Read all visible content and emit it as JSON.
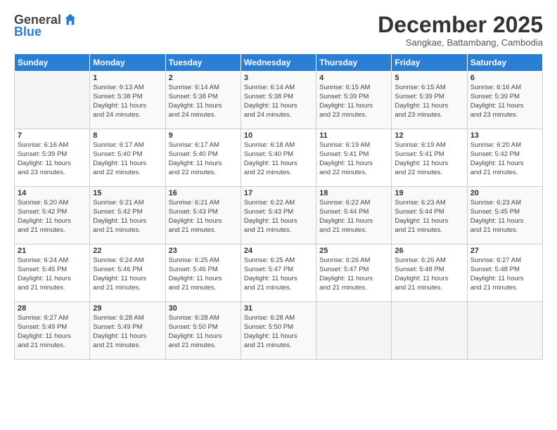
{
  "header": {
    "logo_line1": "General",
    "logo_line2": "Blue",
    "month_title": "December 2025",
    "location": "Sangkae, Battambang, Cambodia"
  },
  "days_of_week": [
    "Sunday",
    "Monday",
    "Tuesday",
    "Wednesday",
    "Thursday",
    "Friday",
    "Saturday"
  ],
  "weeks": [
    [
      {
        "day": "",
        "text": ""
      },
      {
        "day": "1",
        "text": "Sunrise: 6:13 AM\nSunset: 5:38 PM\nDaylight: 11 hours\nand 24 minutes."
      },
      {
        "day": "2",
        "text": "Sunrise: 6:14 AM\nSunset: 5:38 PM\nDaylight: 11 hours\nand 24 minutes."
      },
      {
        "day": "3",
        "text": "Sunrise: 6:14 AM\nSunset: 5:38 PM\nDaylight: 11 hours\nand 24 minutes."
      },
      {
        "day": "4",
        "text": "Sunrise: 6:15 AM\nSunset: 5:39 PM\nDaylight: 11 hours\nand 23 minutes."
      },
      {
        "day": "5",
        "text": "Sunrise: 6:15 AM\nSunset: 5:39 PM\nDaylight: 11 hours\nand 23 minutes."
      },
      {
        "day": "6",
        "text": "Sunrise: 6:16 AM\nSunset: 5:39 PM\nDaylight: 11 hours\nand 23 minutes."
      }
    ],
    [
      {
        "day": "7",
        "text": "Sunrise: 6:16 AM\nSunset: 5:39 PM\nDaylight: 11 hours\nand 23 minutes."
      },
      {
        "day": "8",
        "text": "Sunrise: 6:17 AM\nSunset: 5:40 PM\nDaylight: 11 hours\nand 22 minutes."
      },
      {
        "day": "9",
        "text": "Sunrise: 6:17 AM\nSunset: 5:40 PM\nDaylight: 11 hours\nand 22 minutes."
      },
      {
        "day": "10",
        "text": "Sunrise: 6:18 AM\nSunset: 5:40 PM\nDaylight: 11 hours\nand 22 minutes."
      },
      {
        "day": "11",
        "text": "Sunrise: 6:19 AM\nSunset: 5:41 PM\nDaylight: 11 hours\nand 22 minutes."
      },
      {
        "day": "12",
        "text": "Sunrise: 6:19 AM\nSunset: 5:41 PM\nDaylight: 11 hours\nand 22 minutes."
      },
      {
        "day": "13",
        "text": "Sunrise: 6:20 AM\nSunset: 5:42 PM\nDaylight: 11 hours\nand 21 minutes."
      }
    ],
    [
      {
        "day": "14",
        "text": "Sunrise: 6:20 AM\nSunset: 5:42 PM\nDaylight: 11 hours\nand 21 minutes."
      },
      {
        "day": "15",
        "text": "Sunrise: 6:21 AM\nSunset: 5:42 PM\nDaylight: 11 hours\nand 21 minutes."
      },
      {
        "day": "16",
        "text": "Sunrise: 6:21 AM\nSunset: 5:43 PM\nDaylight: 11 hours\nand 21 minutes."
      },
      {
        "day": "17",
        "text": "Sunrise: 6:22 AM\nSunset: 5:43 PM\nDaylight: 11 hours\nand 21 minutes."
      },
      {
        "day": "18",
        "text": "Sunrise: 6:22 AM\nSunset: 5:44 PM\nDaylight: 11 hours\nand 21 minutes."
      },
      {
        "day": "19",
        "text": "Sunrise: 6:23 AM\nSunset: 5:44 PM\nDaylight: 11 hours\nand 21 minutes."
      },
      {
        "day": "20",
        "text": "Sunrise: 6:23 AM\nSunset: 5:45 PM\nDaylight: 11 hours\nand 21 minutes."
      }
    ],
    [
      {
        "day": "21",
        "text": "Sunrise: 6:24 AM\nSunset: 5:45 PM\nDaylight: 11 hours\nand 21 minutes."
      },
      {
        "day": "22",
        "text": "Sunrise: 6:24 AM\nSunset: 5:46 PM\nDaylight: 11 hours\nand 21 minutes."
      },
      {
        "day": "23",
        "text": "Sunrise: 6:25 AM\nSunset: 5:46 PM\nDaylight: 11 hours\nand 21 minutes."
      },
      {
        "day": "24",
        "text": "Sunrise: 6:25 AM\nSunset: 5:47 PM\nDaylight: 11 hours\nand 21 minutes."
      },
      {
        "day": "25",
        "text": "Sunrise: 6:26 AM\nSunset: 5:47 PM\nDaylight: 11 hours\nand 21 minutes."
      },
      {
        "day": "26",
        "text": "Sunrise: 6:26 AM\nSunset: 5:48 PM\nDaylight: 11 hours\nand 21 minutes."
      },
      {
        "day": "27",
        "text": "Sunrise: 6:27 AM\nSunset: 5:48 PM\nDaylight: 11 hours\nand 21 minutes."
      }
    ],
    [
      {
        "day": "28",
        "text": "Sunrise: 6:27 AM\nSunset: 5:49 PM\nDaylight: 11 hours\nand 21 minutes."
      },
      {
        "day": "29",
        "text": "Sunrise: 6:28 AM\nSunset: 5:49 PM\nDaylight: 11 hours\nand 21 minutes."
      },
      {
        "day": "30",
        "text": "Sunrise: 6:28 AM\nSunset: 5:50 PM\nDaylight: 11 hours\nand 21 minutes."
      },
      {
        "day": "31",
        "text": "Sunrise: 6:28 AM\nSunset: 5:50 PM\nDaylight: 11 hours\nand 21 minutes."
      },
      {
        "day": "",
        "text": ""
      },
      {
        "day": "",
        "text": ""
      },
      {
        "day": "",
        "text": ""
      }
    ]
  ]
}
